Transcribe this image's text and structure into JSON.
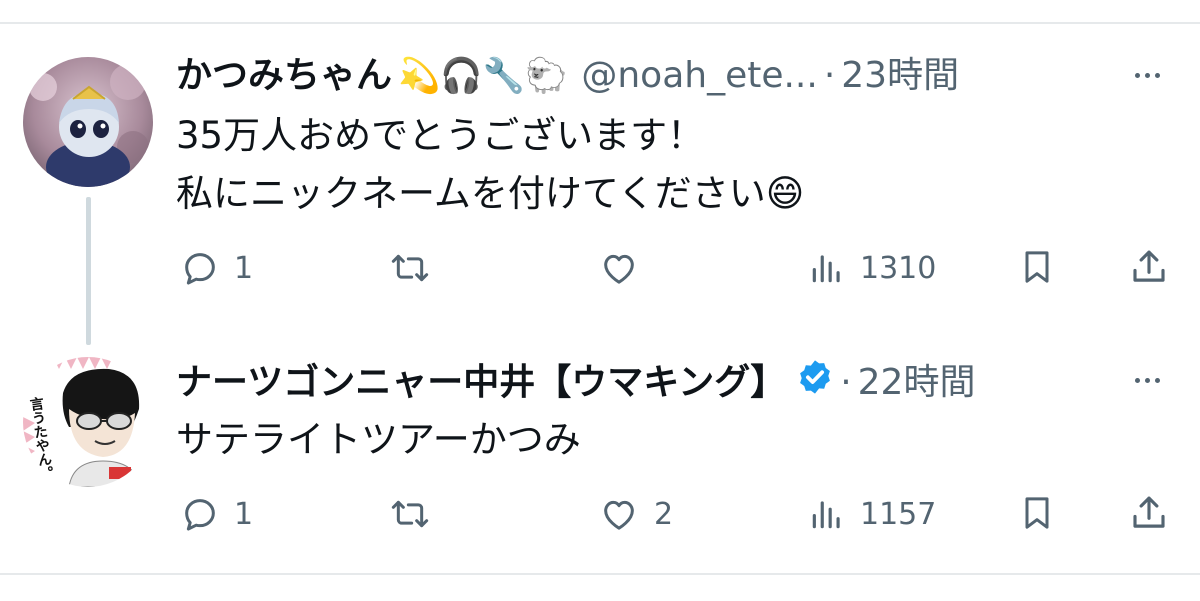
{
  "tweets": [
    {
      "display_name": "かつみちゃん",
      "emojis": "💫🎧🔧🐑",
      "handle": "@noah_ete...",
      "separator": "·",
      "time": "23時間",
      "text": "35万人おめでとうございます！\n私にニックネームを付けてください😄",
      "avatar_icon": "character-avatar",
      "verified": false,
      "actions": {
        "reply_count": "1",
        "retweet_count": "",
        "like_count": "",
        "views_count": "1310"
      }
    },
    {
      "display_name": "ナーツゴンニャー中井【ウマキング】",
      "handle": "",
      "separator": "·",
      "time": "22時間",
      "text": "サテライトツアーかつみ",
      "avatar_icon": "cartoon-avatar",
      "avatar_lettering": "言うたやん。",
      "verified": true,
      "actions": {
        "reply_count": "1",
        "retweet_count": "",
        "like_count": "2",
        "views_count": "1157"
      }
    }
  ],
  "icons": {
    "reply": "reply-icon",
    "retweet": "retweet-icon",
    "like": "like-icon",
    "views": "views-icon",
    "bookmark": "bookmark-icon",
    "share": "share-icon",
    "more": "more-icon",
    "verified": "verified-badge-icon"
  },
  "colors": {
    "text": "#0f1419",
    "secondary": "#536471",
    "divider": "#e6e9eb",
    "thread_line": "#cfd9de",
    "verified_blue": "#1d9bf0"
  }
}
